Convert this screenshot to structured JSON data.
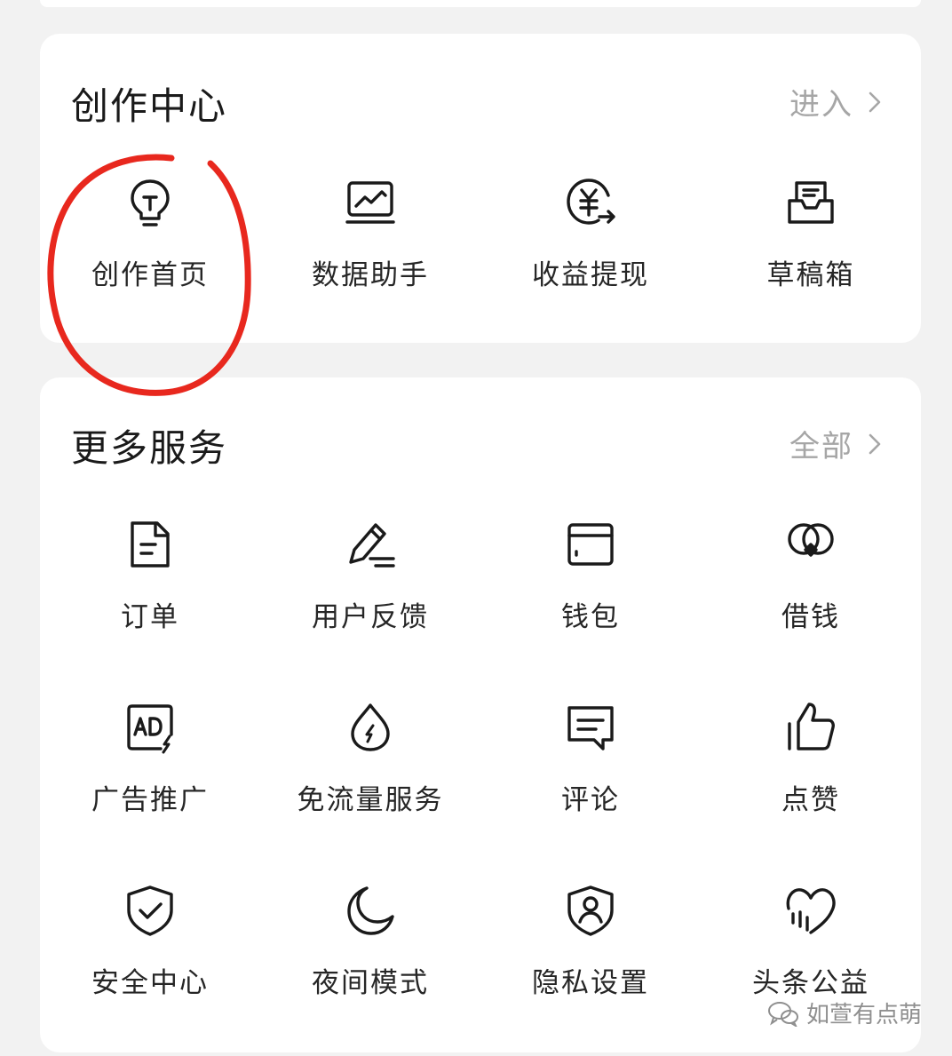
{
  "creation_center": {
    "title": "创作中心",
    "link_label": "进入",
    "items": [
      {
        "label": "创作首页",
        "icon": "lightbulb-icon"
      },
      {
        "label": "数据助手",
        "icon": "chart-monitor-icon"
      },
      {
        "label": "收益提现",
        "icon": "yuan-withdraw-icon"
      },
      {
        "label": "草稿箱",
        "icon": "draft-box-icon"
      }
    ]
  },
  "more_services": {
    "title": "更多服务",
    "link_label": "全部",
    "items": [
      {
        "label": "订单",
        "icon": "order-document-icon"
      },
      {
        "label": "用户反馈",
        "icon": "pen-feedback-icon"
      },
      {
        "label": "钱包",
        "icon": "wallet-icon"
      },
      {
        "label": "借钱",
        "icon": "loan-coins-icon"
      },
      {
        "label": "广告推广",
        "icon": "ad-promotion-icon"
      },
      {
        "label": "免流量服务",
        "icon": "water-drop-icon"
      },
      {
        "label": "评论",
        "icon": "comment-icon"
      },
      {
        "label": "点赞",
        "icon": "thumbs-up-icon"
      },
      {
        "label": "安全中心",
        "icon": "shield-check-icon"
      },
      {
        "label": "夜间模式",
        "icon": "moon-icon"
      },
      {
        "label": "隐私设置",
        "icon": "privacy-shield-icon"
      },
      {
        "label": "头条公益",
        "icon": "charity-heart-icon"
      }
    ]
  },
  "watermark": {
    "text": "如萱有点萌"
  },
  "colors": {
    "card_background": "#ffffff",
    "page_background": "#f2f2f2",
    "link_gray": "#a6a6a6",
    "annotation_red": "#e8281e"
  }
}
